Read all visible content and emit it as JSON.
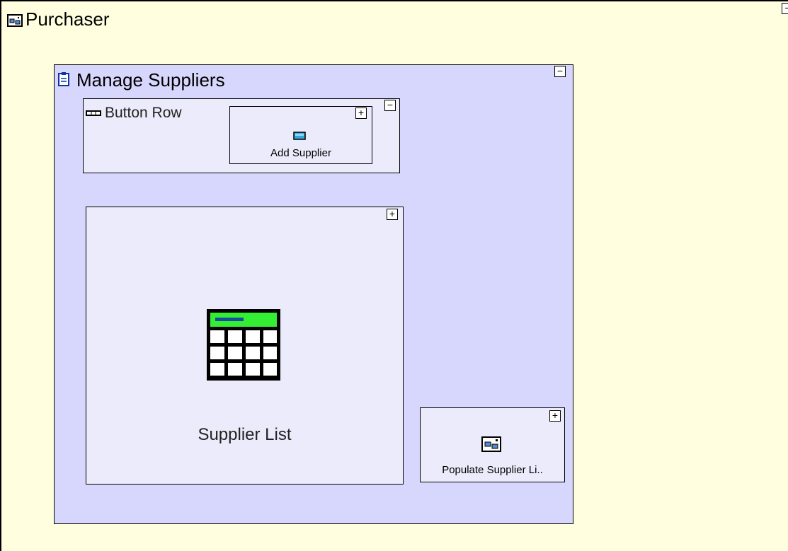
{
  "root": {
    "title": "Purchaser",
    "toggle": "−"
  },
  "manage_suppliers": {
    "title": "Manage Suppliers",
    "toggle": "−",
    "button_row": {
      "title": "Button Row",
      "toggle": "−",
      "add_supplier": {
        "label": "Add Supplier",
        "toggle": "+"
      }
    },
    "supplier_list": {
      "label": "Supplier List",
      "toggle": "+"
    },
    "populate_supplier_list": {
      "label": "Populate Supplier Li..",
      "toggle": "+"
    }
  },
  "colors": {
    "canvas": "#ffffe0",
    "container": "#d7d7fd",
    "inner_box": "#ebebfb",
    "grid_header": "#33ee33"
  },
  "icons": {
    "root": "window-icon",
    "manage_suppliers": "clipboard-icon",
    "button_row": "button-row-icon",
    "add_supplier": "button-icon",
    "supplier_list": "table-grid-icon",
    "populate": "window-icon"
  }
}
